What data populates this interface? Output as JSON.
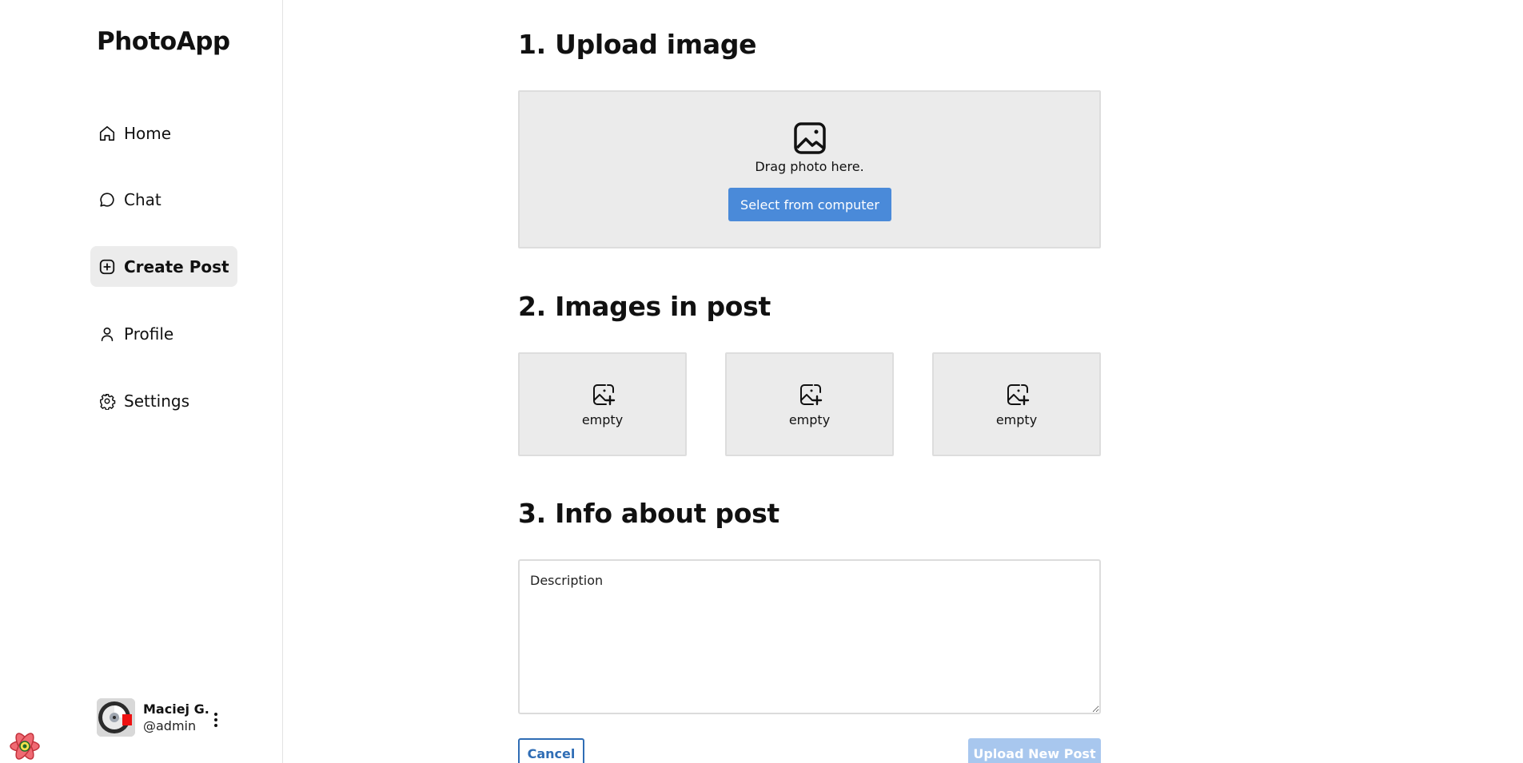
{
  "app": {
    "name": "PhotoApp"
  },
  "sidebar": {
    "items": [
      {
        "label": "Home",
        "icon": "home-icon",
        "active": false
      },
      {
        "label": "Chat",
        "icon": "chat-bubble-icon",
        "active": false
      },
      {
        "label": "Create Post",
        "icon": "plus-square-icon",
        "active": true
      },
      {
        "label": "Profile",
        "icon": "user-icon",
        "active": false
      },
      {
        "label": "Settings",
        "icon": "gear-icon",
        "active": false
      }
    ],
    "user": {
      "name": "Maciej G.",
      "handle": "@admin",
      "menu_icon": "more-vertical-icon"
    }
  },
  "sections": {
    "upload": {
      "title": "1. Upload image",
      "drag_text": "Drag photo here.",
      "button_label": "Select from computer",
      "icon": "image-icon"
    },
    "images": {
      "title": "2. Images in post",
      "slots": [
        {
          "label": "empty",
          "icon": "image-plus-icon"
        },
        {
          "label": "empty",
          "icon": "image-plus-icon"
        },
        {
          "label": "empty",
          "icon": "image-plus-icon"
        }
      ]
    },
    "info": {
      "title": "3. Info about post",
      "description_placeholder": "Description",
      "description_value": ""
    }
  },
  "actions": {
    "cancel_label": "Cancel",
    "submit_label": "Upload New Post",
    "submit_enabled": false
  },
  "colors": {
    "primary": "#4a8ad9",
    "cancel_border": "#2f6db5",
    "submit_disabled": "#a8c7ee",
    "panel_bg": "#ebebeb",
    "active_nav_bg": "#ececec"
  }
}
